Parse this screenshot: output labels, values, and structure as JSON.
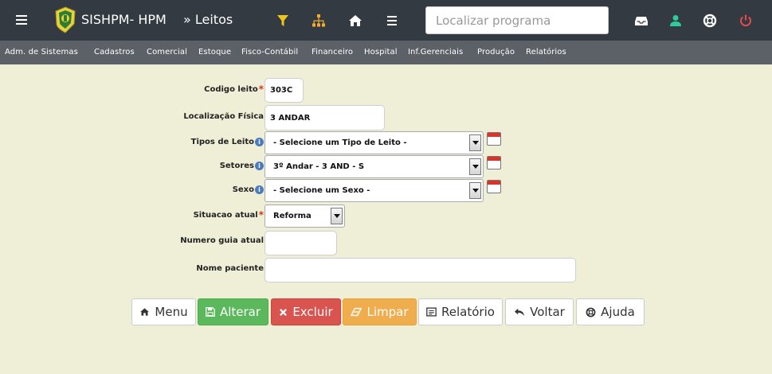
{
  "header": {
    "app_title": "SISHPM- HPM",
    "breadcrumb": "» Leitos",
    "search_placeholder": "Localizar programa"
  },
  "menu": [
    "Adm. de Sistemas",
    "Cadastros",
    "Comercial",
    "Estoque",
    "Fisco-Contábil",
    "Financeiro",
    "Hospital",
    "Inf.Gerenciais",
    "Produção",
    "Relatórios"
  ],
  "form": {
    "codigo_label": "Codigo leito",
    "codigo_value": "303C",
    "localizacao_label": "Localização Física",
    "localizacao_value": "3 ANDAR",
    "tipos_label": "Tipos de Leito",
    "tipos_value": "- Selecione um Tipo de Leito -",
    "setores_label": "Setores",
    "setores_value": "3º Andar - 3 AND - S",
    "sexo_label": "Sexo",
    "sexo_value": "- Selecione um Sexo -",
    "situacao_label": "Situacao atual",
    "situacao_value": "Reforma",
    "numero_guia_label": "Numero guia atual",
    "numero_guia_value": "",
    "nome_paciente_label": "Nome paciente",
    "nome_paciente_value": "",
    "required_mark": "*",
    "info_glyph": "i"
  },
  "buttons": {
    "menu": "Menu",
    "alterar": "Alterar",
    "excluir": "Excluir",
    "limpar": "Limpar",
    "relatorio": "Relatório",
    "voltar": "Voltar",
    "ajuda": "Ajuda"
  },
  "colors": {
    "topbar": "#333a41",
    "menubar": "#5c6167",
    "background": "#efefd7",
    "green": "#5cb85c",
    "red": "#d9534f",
    "orange": "#f0ad4e"
  }
}
